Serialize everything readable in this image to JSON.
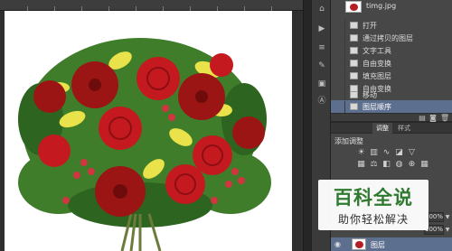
{
  "document": {
    "filename": "timg.jpg"
  },
  "history": {
    "items": [
      {
        "label": "打开",
        "selected": false
      },
      {
        "label": "通过拷贝的图层",
        "selected": false
      },
      {
        "label": "文字工具",
        "selected": false
      },
      {
        "label": "自由变换",
        "selected": false
      },
      {
        "label": "填充图层",
        "selected": false
      },
      {
        "label": "自由变换",
        "selected": false
      },
      {
        "label": "移动",
        "selected": false
      },
      {
        "label": "图层顺序",
        "selected": true
      }
    ]
  },
  "adjustments": {
    "tabs": [
      "调整",
      "样式"
    ],
    "title": "添加调整"
  },
  "layers": {
    "opacity_value": "100%",
    "fill_value": "100%",
    "active_layer_name": "图层"
  },
  "watermark": {
    "title": "百科全说",
    "subtitle": "助你轻松解决"
  },
  "colors": {
    "selection": "#5d6f8f",
    "panel": "#474747",
    "watermark_green": "#2f7a2f"
  }
}
